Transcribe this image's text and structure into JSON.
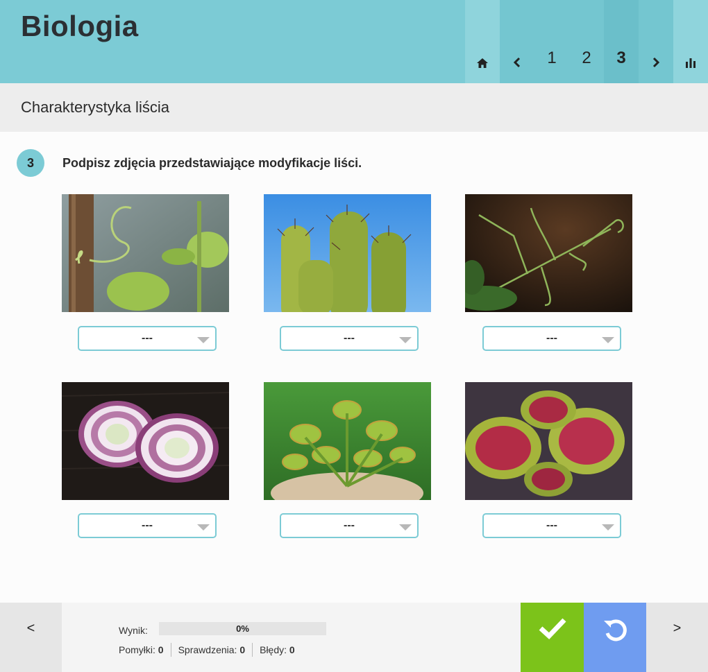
{
  "header": {
    "title": "Biologia",
    "nav": {
      "home_icon": "home-icon",
      "prev_icon": "chevron-left-icon",
      "pages": [
        "1",
        "2",
        "3"
      ],
      "current_page": "3",
      "next_icon": "chevron-right-icon",
      "stats_icon": "bar-chart-icon"
    }
  },
  "section": {
    "title": "Charakterystyka liścia"
  },
  "question": {
    "number": "3",
    "text": "Podpisz zdjęcia przedstawiające modyfikacje liści.",
    "items": [
      {
        "image": "pea tendrils on stake",
        "select_value": "---"
      },
      {
        "image": "cactus spines",
        "select_value": "---"
      },
      {
        "image": "plant tendrils on dark background",
        "select_value": "---"
      },
      {
        "image": "red onion halves",
        "select_value": "---"
      },
      {
        "image": "venus flytrap",
        "select_value": "---"
      },
      {
        "image": "coleus leaves",
        "select_value": "---"
      }
    ]
  },
  "footer": {
    "prev_label": "<",
    "next_label": ">",
    "score_label": "Wynik:",
    "score_value": "0%",
    "score_fraction": 0,
    "stats": {
      "mistakes_label": "Pomyłki:",
      "mistakes_value": "0",
      "checks_label": "Sprawdzenia:",
      "checks_value": "0",
      "errors_label": "Błędy:",
      "errors_value": "0"
    },
    "check_icon": "checkmark-icon",
    "reset_icon": "reset-icon"
  },
  "colors": {
    "accent": "#7ccbd5",
    "check_green": "#7cc31a",
    "reset_blue": "#6f9cf0"
  }
}
